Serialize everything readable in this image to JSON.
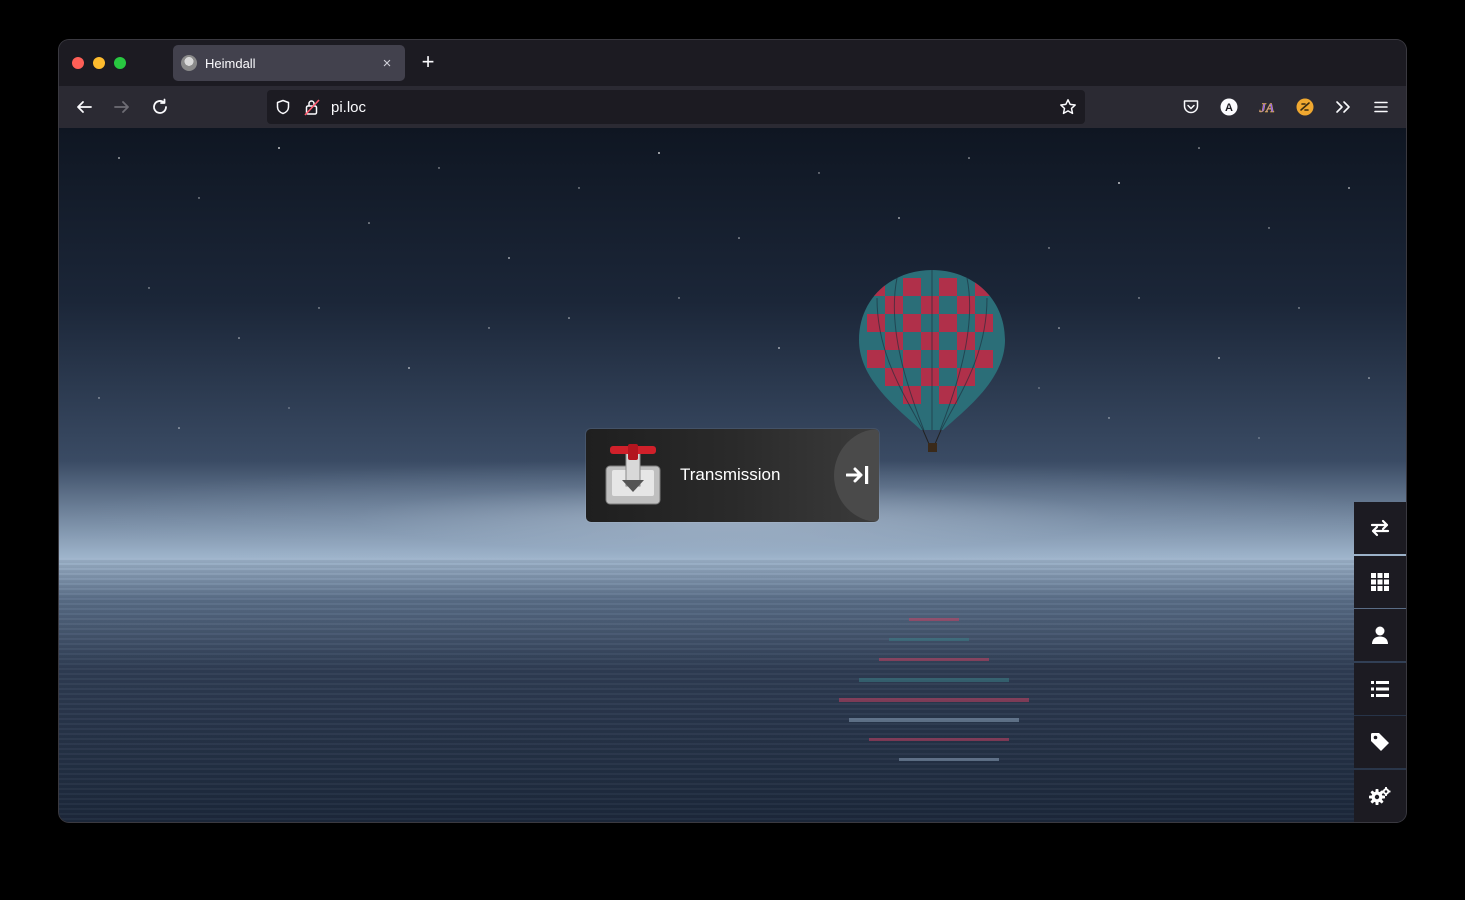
{
  "browser": {
    "tab": {
      "title": "Heimdall",
      "favicon": "heimdall-favicon-icon"
    },
    "url": "pi.loc",
    "toolbar_icons": [
      "pocket-icon",
      "account-icon",
      "extension-icon",
      "extension-icon",
      "overflow-icon",
      "menu-icon"
    ]
  },
  "app_card": {
    "title": "Transmission",
    "icon": "transmission-icon",
    "link_icon": "open-link-icon"
  },
  "side_menu": [
    "swap-icon",
    "grid-icon",
    "user-icon",
    "list-icon",
    "tag-icon",
    "settings-icon"
  ]
}
